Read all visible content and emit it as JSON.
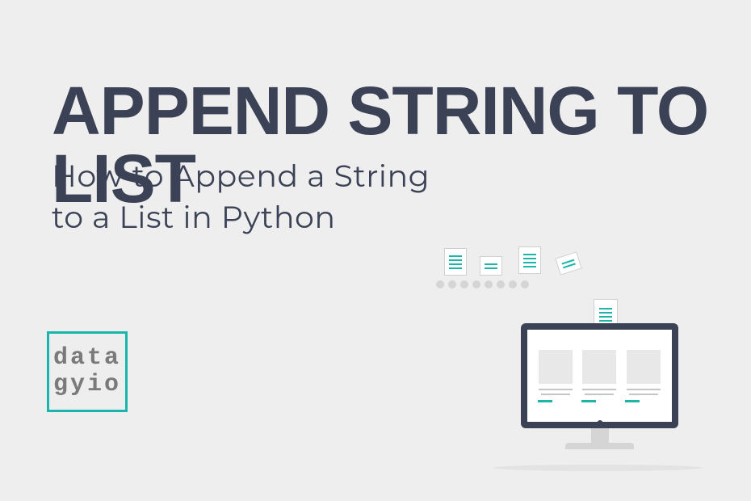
{
  "heading": "APPEND STRING TO LIST",
  "subheading_line1": "How to Append a String",
  "subheading_line2": "to a List in Python",
  "logo": {
    "line1": "data",
    "line2": "gyio"
  }
}
